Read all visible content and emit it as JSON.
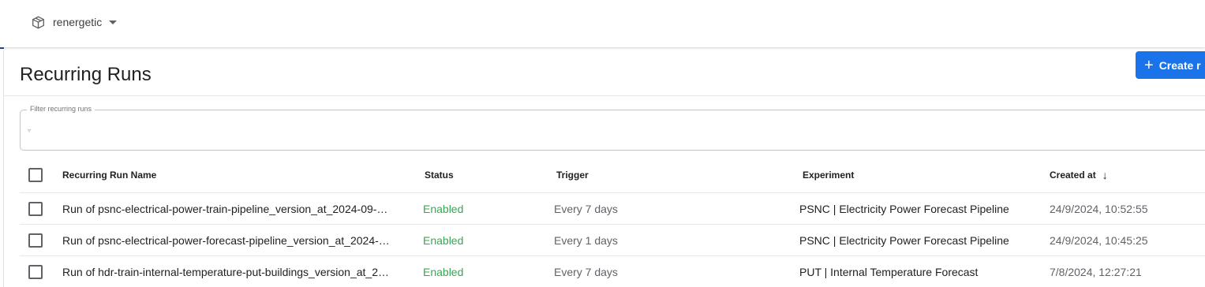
{
  "topbar": {
    "namespace": "renergetic"
  },
  "page": {
    "title": "Recurring Runs",
    "create_button": "Create r"
  },
  "filter": {
    "label": "Filter recurring runs",
    "icon": "filter-icon"
  },
  "table": {
    "columns": {
      "name": "Recurring Run Name",
      "status": "Status",
      "trigger": "Trigger",
      "experiment": "Experiment",
      "created": "Created at"
    },
    "rows": [
      {
        "name": "Run of psnc-electrical-power-train-pipeline_version_at_2024-09-…",
        "status": "Enabled",
        "trigger": "Every 7 days",
        "experiment": "PSNC | Electricity Power Forecast Pipeline",
        "created": "24/9/2024, 10:52:55"
      },
      {
        "name": "Run of psnc-electrical-power-forecast-pipeline_version_at_2024-…",
        "status": "Enabled",
        "trigger": "Every 1 days",
        "experiment": "PSNC | Electricity Power Forecast Pipeline",
        "created": "24/9/2024, 10:45:25"
      },
      {
        "name": "Run of hdr-train-internal-temperature-put-buildings_version_at_2…",
        "status": "Enabled",
        "trigger": "Every 7 days",
        "experiment": "PUT | Internal Temperature Forecast",
        "created": "7/8/2024, 12:27:21"
      }
    ]
  },
  "colors": {
    "accent": "#1a73e8",
    "status_enabled": "#34a853",
    "sidebar_edge": "#1f4e8c"
  }
}
